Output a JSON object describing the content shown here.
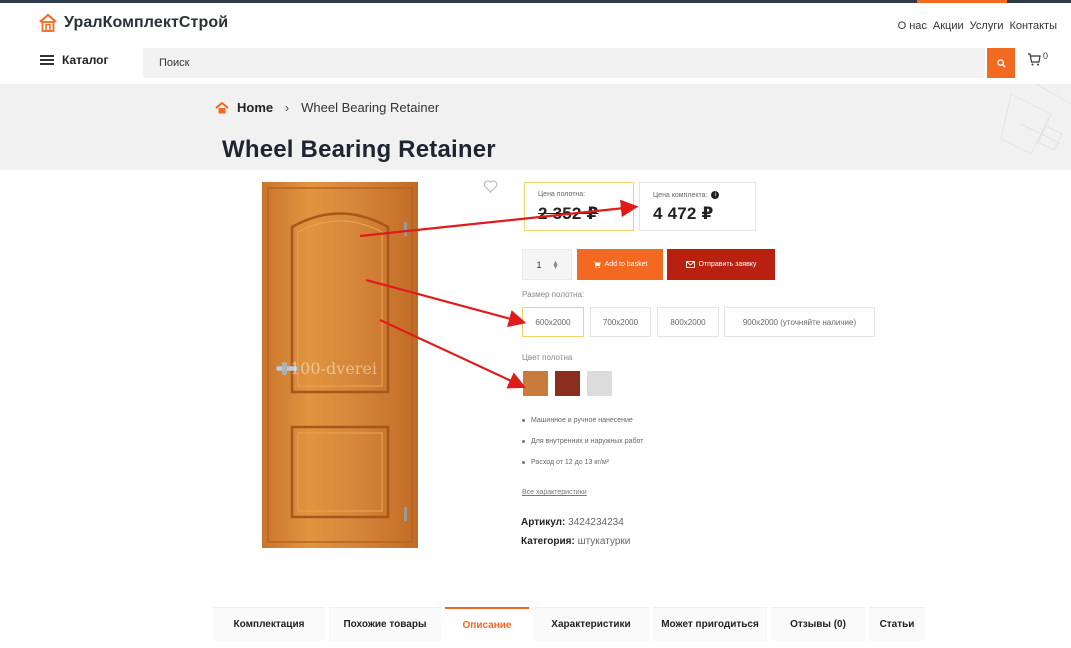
{
  "brand": {
    "name": "УралКомплектСтрой",
    "accent": "#f26a21",
    "dark": "#2c3a4a",
    "danger": "#b8200f"
  },
  "topnav": [
    "О нас",
    "Акции",
    "Услуги",
    "Контакты"
  ],
  "search": {
    "catalog_label": "Каталог",
    "placeholder": "Поиск",
    "cart_count": "0"
  },
  "breadcrumb": {
    "home": "Home",
    "current": "Wheel Bearing Retainer"
  },
  "product": {
    "title": "Wheel Bearing Retainer",
    "watermark": "100-dverei",
    "price_old_label": "Цена полотна:",
    "price_old": "2 352 ₽",
    "price_kit_label": "Цена комплекта:",
    "price_kit": "4 472 ₽",
    "qty": "1",
    "add_to_basket": "Add to basket",
    "send_request": "Отправить заявку",
    "size_label": "Размер полотна:",
    "sizes": [
      "600x2000",
      "700x2000",
      "800x2000",
      "900x2000 (уточняйте наличие)"
    ],
    "color_label": "Цвет полотна",
    "colors": [
      "#c87b3a",
      "#8a2f1e",
      "#dcdcdc"
    ],
    "features": [
      "Машинное и ручное нанесение",
      "Для внутренних и наружных работ",
      "Расход от 12 до 13 кг/м²"
    ],
    "all_specs": "Все характеристики",
    "sku_label": "Артикул:",
    "sku": "3424234234",
    "category_label": "Категория:",
    "category": "штукатурки"
  },
  "tabs": [
    "Комплектация",
    "Похожие товары",
    "Описание",
    "Характеристики",
    "Может пригодиться",
    "Отзывы (0)",
    "Статьи"
  ],
  "icons": [
    "home-logo-icon",
    "menu-icon",
    "search-icon",
    "cart-icon",
    "home-icon",
    "heart-icon",
    "info-icon",
    "cart-small-icon",
    "mail-icon"
  ]
}
